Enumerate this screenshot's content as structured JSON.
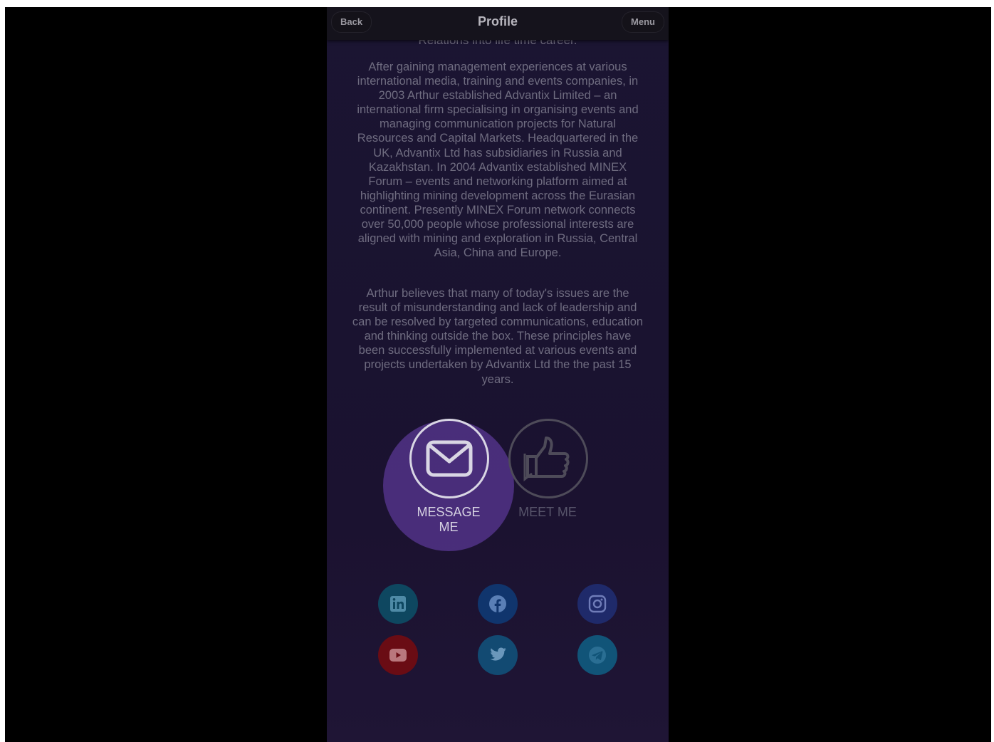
{
  "header": {
    "back_label": "Back",
    "title": "Profile",
    "menu_label": "Menu"
  },
  "bio": {
    "cut_line": "Relations into life time career.",
    "paragraph_1": "After gaining management experiences at various international media, training and events companies, in 2003 Arthur established Advantix Limited – an international firm specialising in organising events and managing communication projects for Natural Resources and Capital Markets. Headquartered in the UK, Advantix Ltd has subsidiaries in Russia and Kazakhstan. In 2004 Advantix established MINEX Forum – events and networking platform aimed at highlighting mining development across the Eurasian continent. Presently MINEX Forum network connects over 50,000 people whose professional interests are aligned with mining and exploration in Russia, Central Asia, China and Europe.",
    "paragraph_2": "Arthur believes that many of today's issues are the result of misunderstanding and lack of leadership and can be resolved by targeted communications, education and thinking outside the box. These principles have been successfully implemented at various events and projects undertaken by Advantix Ltd the the past 15 years."
  },
  "actions": {
    "message_label": "MESSAGE ME",
    "message_icon": "envelope-icon",
    "meet_label": "MEET ME",
    "meet_icon": "thumbs-up-icon"
  },
  "social": [
    {
      "icon": "linkedin-icon",
      "color": "#0e4760"
    },
    {
      "icon": "facebook-icon",
      "color": "#10356d"
    },
    {
      "icon": "instagram-icon",
      "color": "#1f2a6a"
    },
    {
      "icon": "youtube-icon",
      "color": "#6a0c14"
    },
    {
      "icon": "twitter-icon",
      "color": "#124a72"
    },
    {
      "icon": "telegram-icon",
      "color": "#115478"
    }
  ],
  "colors": {
    "background": "#000000",
    "panel": "#1b1532",
    "accent_glow": "#4c2f7e"
  }
}
